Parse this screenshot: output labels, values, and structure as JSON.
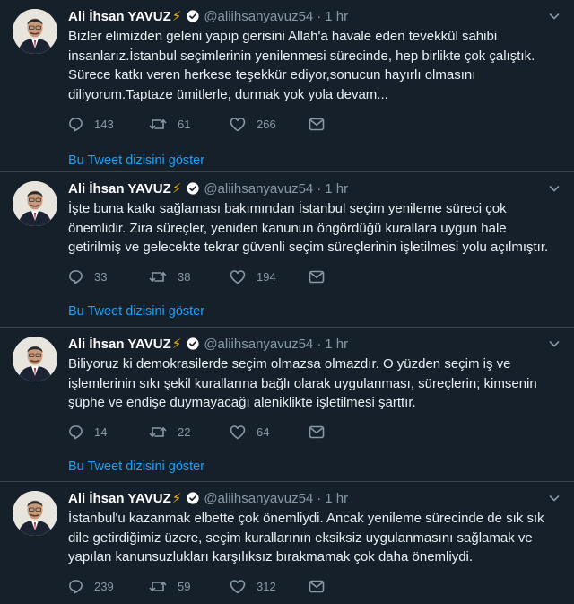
{
  "tweets": [
    {
      "name": "Ali İhsan YAVUZ",
      "bolt": "⚡",
      "handle": "@aliihsanyavuz54",
      "dot": "·",
      "time": "1 hr",
      "lines": [
        "Bizler elimizden geleni yapıp gerisini Allah'a havale eden tevekkül sahibi",
        "insanlarız.İstanbul seçimlerinin yenilenmesi sürecinde, hep birlikte çok çalıştık.",
        "Sürece katkı veren herkese teşekkür ediyor,sonucun hayırlı olmasını",
        "diliyorum.Taptaze ümitlerle, durmak yok yola devam..."
      ],
      "replies": "143",
      "retweets": "61",
      "likes": "266",
      "show_thread": "Bu Tweet dizisini göster"
    },
    {
      "name": "Ali İhsan YAVUZ",
      "bolt": "⚡",
      "handle": "@aliihsanyavuz54",
      "dot": "·",
      "time": "1 hr",
      "lines": [
        "İşte buna katkı sağlaması bakımından İstanbul seçim yenileme süreci çok",
        "önemlidir. Zira süreçler, yeniden kanunun öngördüğü kurallara uygun hale",
        "getirilmiş ve gelecekte tekrar güvenli seçim süreçlerinin işletilmesi yolu açılmıştır."
      ],
      "replies": "33",
      "retweets": "38",
      "likes": "194",
      "show_thread": "Bu Tweet dizisini göster"
    },
    {
      "name": "Ali İhsan YAVUZ",
      "bolt": "⚡",
      "handle": "@aliihsanyavuz54",
      "dot": "·",
      "time": "1 hr",
      "lines": [
        "Biliyoruz ki demokrasilerde seçim  olmazsa olmazdır. O yüzden seçim iş ve",
        "işlemlerinin sıkı şekil kurallarına bağlı olarak uygulanması, süreçlerin; kimsenin",
        "şüphe ve endişe duymayacağı aleniklikte işletilmesi şarttır."
      ],
      "replies": "14",
      "retweets": "22",
      "likes": "64",
      "show_thread": "Bu Tweet dizisini göster"
    },
    {
      "name": "Ali İhsan YAVUZ",
      "bolt": "⚡",
      "handle": "@aliihsanyavuz54",
      "dot": "·",
      "time": "1 hr",
      "lines": [
        "İstanbul'u kazanmak elbette çok önemliydi. Ancak yenileme sürecinde de sık sık",
        "dile getirdiğimiz üzere, seçim kurallarının eksiksiz uygulanmasını sağlamak ve",
        "yapılan kanunsuzlukları karşılıksız bırakmamak çok daha önemliydi."
      ],
      "replies": "239",
      "retweets": "59",
      "likes": "312"
    }
  ],
  "icons": {
    "reply": "reply-icon",
    "retweet": "retweet-icon",
    "like": "heart-icon",
    "share": "share-icon",
    "more": "chevron-down-icon",
    "verified": "verified-badge-icon"
  },
  "colors": {
    "background": "#15202b",
    "divider": "#38444d",
    "text": "#e9eef2",
    "muted": "#8899a6",
    "link": "#1da1f2",
    "bolt": "#f5b400"
  }
}
